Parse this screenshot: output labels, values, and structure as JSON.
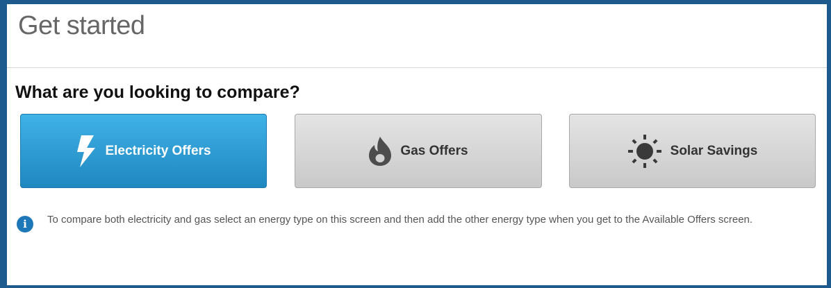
{
  "page": {
    "title": "Get started",
    "question": "What are you looking to compare?"
  },
  "options": [
    {
      "label": "Electricity Offers",
      "icon": "lightning-bolt-icon",
      "selected": true
    },
    {
      "label": "Gas Offers",
      "icon": "flame-icon",
      "selected": false
    },
    {
      "label": "Solar Savings",
      "icon": "sun-icon",
      "selected": false
    }
  ],
  "info": {
    "icon": "info-icon",
    "text": "To compare both electricity and gas select an energy type on this screen and then add the other energy type when you get to the Available Offers screen."
  },
  "colors": {
    "frame": "#1d5a8e",
    "selected_button": "#2a9ad4",
    "unselected_button": "#d6d6d6",
    "info_icon": "#1e77b6"
  }
}
